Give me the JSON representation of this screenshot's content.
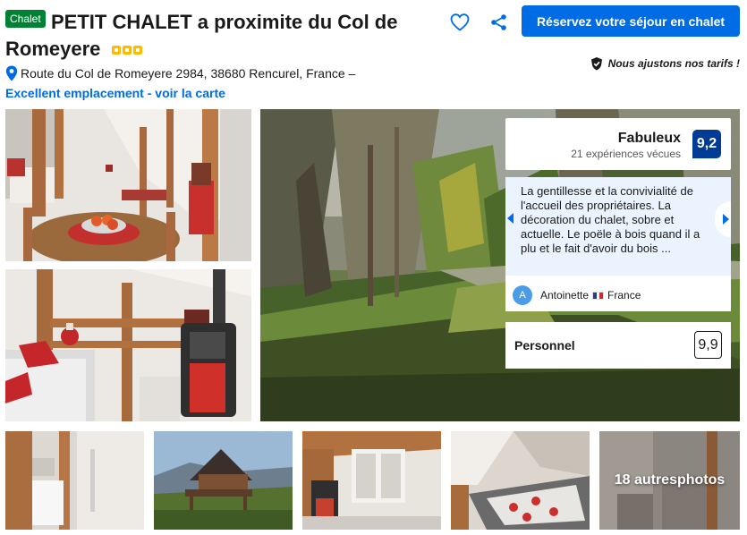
{
  "header": {
    "type_badge": "Chalet",
    "title_line1": "PETIT CHALET a proximite du Col de",
    "title_line2": "Romeyere",
    "star_count": 3,
    "reserve_button": "Réservez votre séjour en chalet",
    "price_match": "Nous ajustons nos tarifs !",
    "address": "Route du Col de Romeyere 2984, 38680 Rencurel, France –",
    "map_link": "Excellent emplacement - voir la carte"
  },
  "icons": {
    "favorite": "heart-icon",
    "share": "share-icon",
    "price_match": "shield-check-icon",
    "location": "map-pin-icon"
  },
  "colors": {
    "brand_blue": "#006ce4",
    "score_blue": "#003b95",
    "type_badge_green": "#008234",
    "star_yellow": "#febb02",
    "review_bg": "#ebf3ff"
  },
  "gallery": {
    "more_photos_label": "18 autres photos"
  },
  "rating": {
    "label": "Fabuleux",
    "reviews_count": "21 expériences vécues",
    "score": "9,2"
  },
  "review": {
    "text": "La gentillesse et la convivialité de l'accueil des propriétaires. La décoration du chalet, sobre et actuelle. Le poële à bois quand il a plu et le fait d'avoir du bois ...",
    "avatar_initial": "A",
    "reviewer_name": "Antoinette",
    "reviewer_country": "France"
  },
  "staff": {
    "label": "Personnel",
    "score": "9,9"
  }
}
